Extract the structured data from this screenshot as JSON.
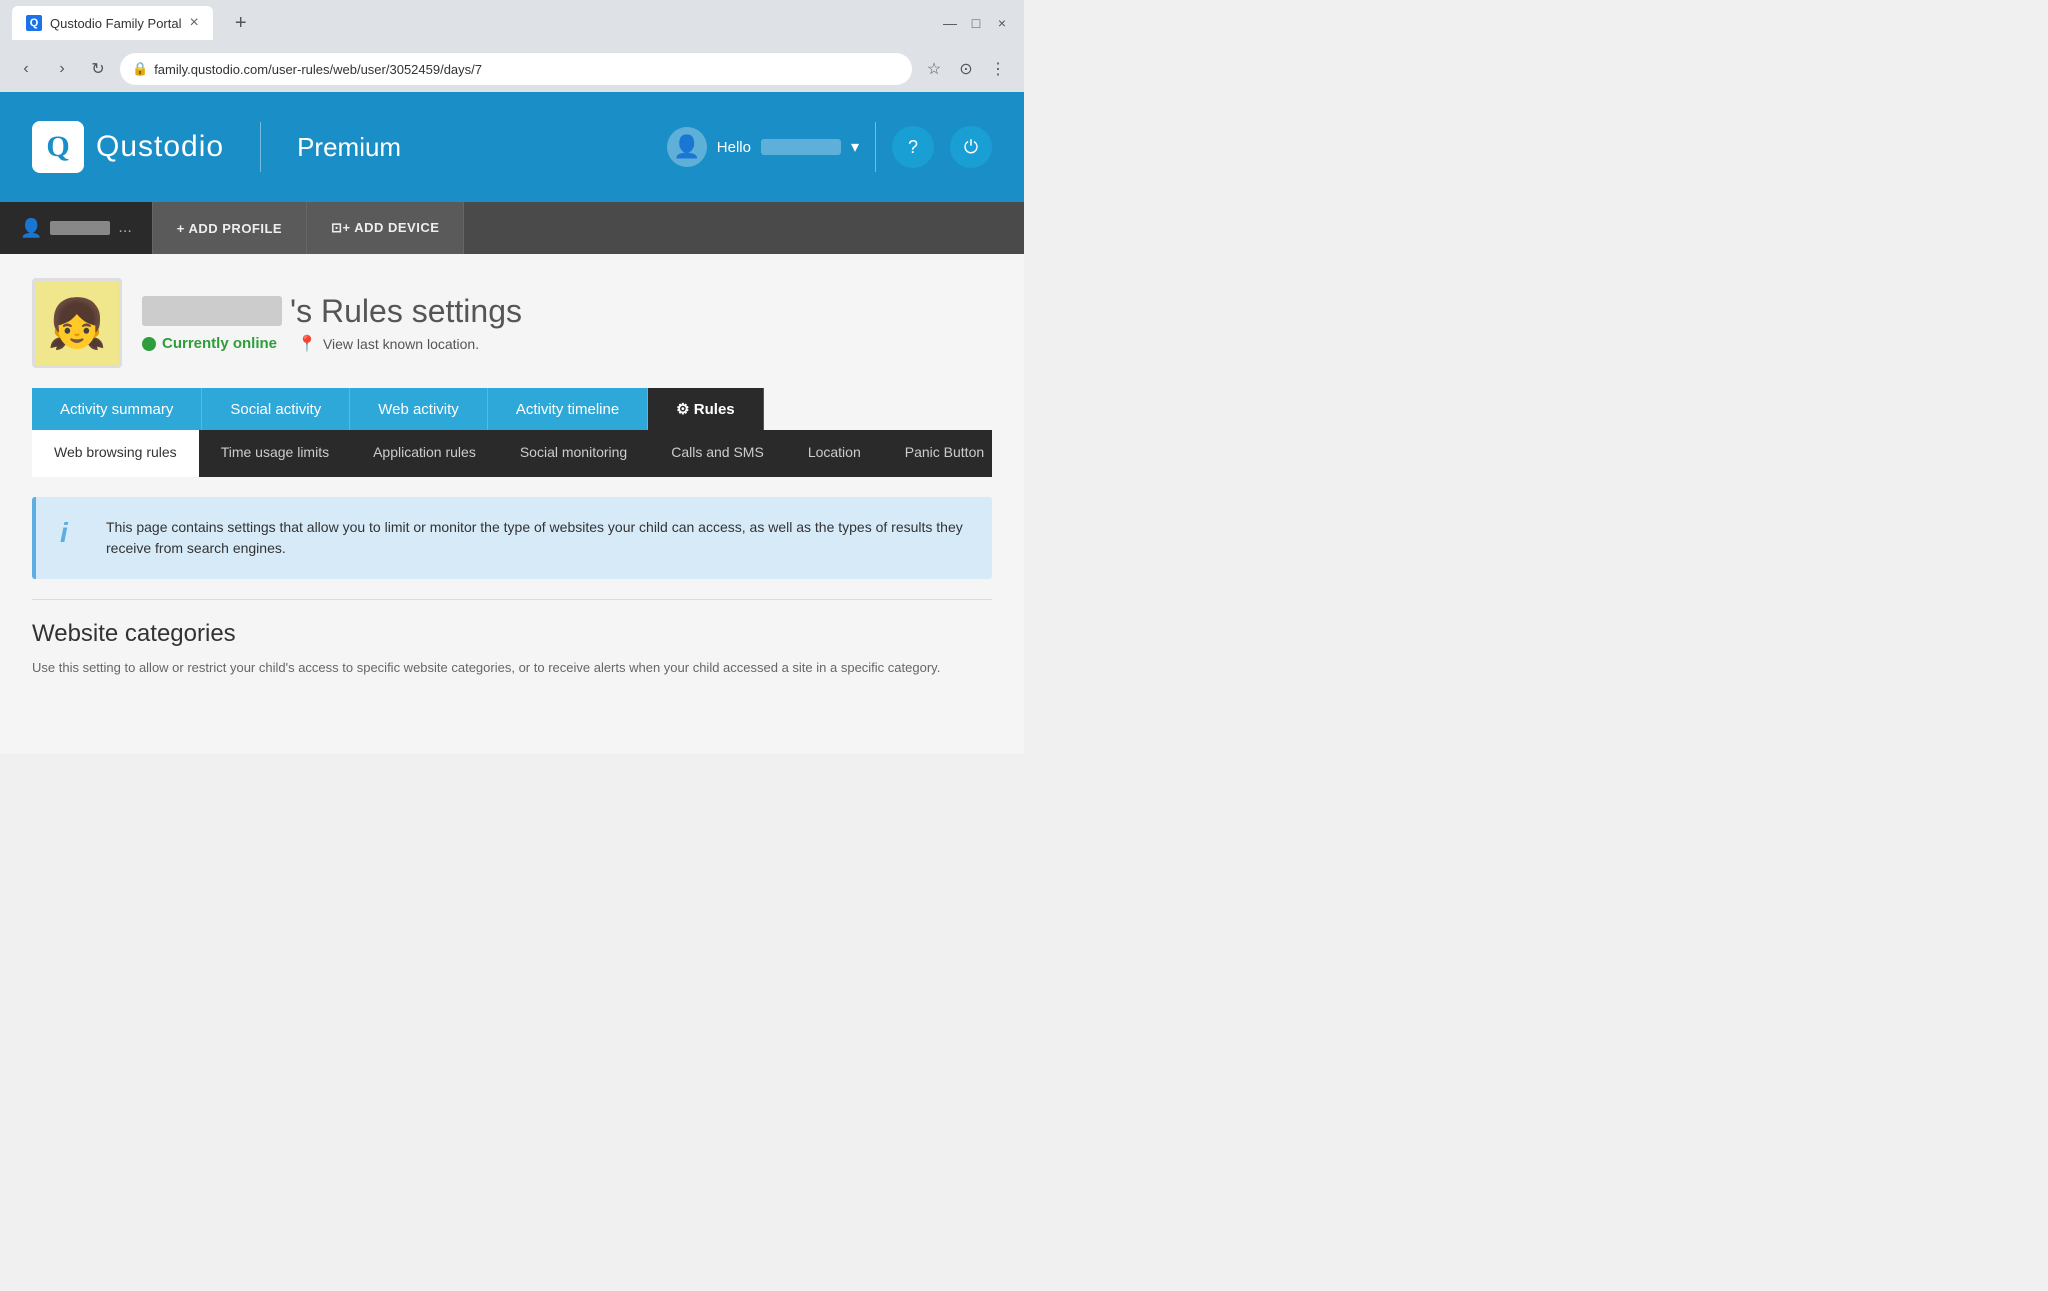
{
  "browser": {
    "tab_title": "Qustodio Family Portal",
    "tab_favicon": "Q",
    "address": "family.qustodio.com/user-rules/web/user/3052459/days/7",
    "new_tab_label": "+",
    "close_label": "×",
    "minimize_label": "—",
    "maximize_label": "□",
    "nav": {
      "back": "‹",
      "forward": "›",
      "refresh": "↻",
      "star": "☆",
      "account": "⊙",
      "menu": "⋮"
    }
  },
  "header": {
    "logo_letter": "Q",
    "logo_name": "Qustodio",
    "plan": "Premium",
    "hello_text": "Hello",
    "username": "••••••••",
    "help_icon": "?",
    "power_icon": "⏻"
  },
  "profile_bar": {
    "profile_icon": "👤",
    "profile_name": "••••••",
    "ellipsis": "...",
    "add_profile_label": "+ ADD PROFILE",
    "add_device_label": "⊡+ ADD DEVICE"
  },
  "child": {
    "name_blurred": "••••••••",
    "rules_title": "'s Rules settings",
    "status": "Currently online",
    "location_link": "View last known location.",
    "avatar_emoji": "👧"
  },
  "main_tabs": [
    {
      "id": "activity_summary",
      "label": "Activity summary",
      "active": false
    },
    {
      "id": "social_activity",
      "label": "Social activity",
      "active": false
    },
    {
      "id": "web_activity",
      "label": "Web activity",
      "active": false
    },
    {
      "id": "activity_timeline",
      "label": "Activity timeline",
      "active": false
    },
    {
      "id": "rules",
      "label": "⚙ Rules",
      "active": true
    }
  ],
  "sub_tabs": [
    {
      "id": "web_browsing",
      "label": "Web browsing rules",
      "active": true
    },
    {
      "id": "time_usage",
      "label": "Time usage limits",
      "active": false
    },
    {
      "id": "application",
      "label": "Application rules",
      "active": false
    },
    {
      "id": "social_monitoring",
      "label": "Social monitoring",
      "active": false
    },
    {
      "id": "calls_sms",
      "label": "Calls and SMS",
      "active": false
    },
    {
      "id": "location",
      "label": "Location",
      "active": false
    },
    {
      "id": "panic_button",
      "label": "Panic Button",
      "active": false
    }
  ],
  "info_box": {
    "icon": "i",
    "text": "This page contains settings that allow you to limit or monitor the type of websites your child can access, as well as the types of results they receive from search engines."
  },
  "website_categories": {
    "title": "Website categories",
    "description": "Use this setting to allow or restrict your child's access to specific website categories, or to receive alerts when your child accessed a site in a specific category."
  }
}
